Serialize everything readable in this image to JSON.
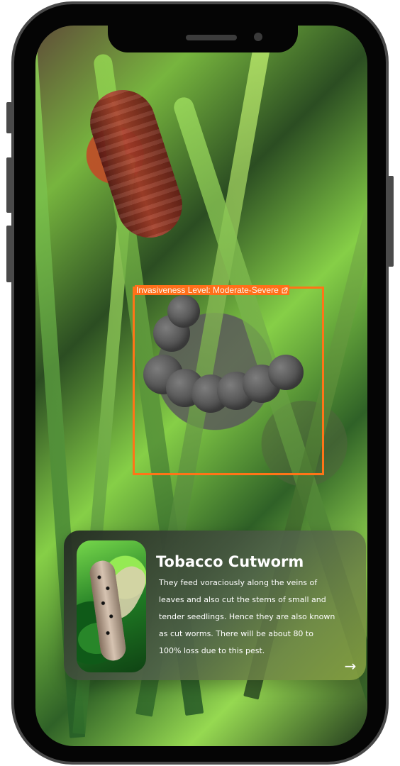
{
  "detection": {
    "label": "Invasiveness Level: Moderate-Severe",
    "accent": "#ff6f1a",
    "icon": "external-link-icon"
  },
  "pest_card": {
    "title": "Tobacco Cutworm",
    "description": "They feed voraciously along the veins of leaves and also cut the stems of small and tender seedlings. Hence they are also known as cut worms. There will be about 80 to 100% loss due to this pest.",
    "arrow": "→",
    "arrow_icon": "arrow-right-icon"
  }
}
